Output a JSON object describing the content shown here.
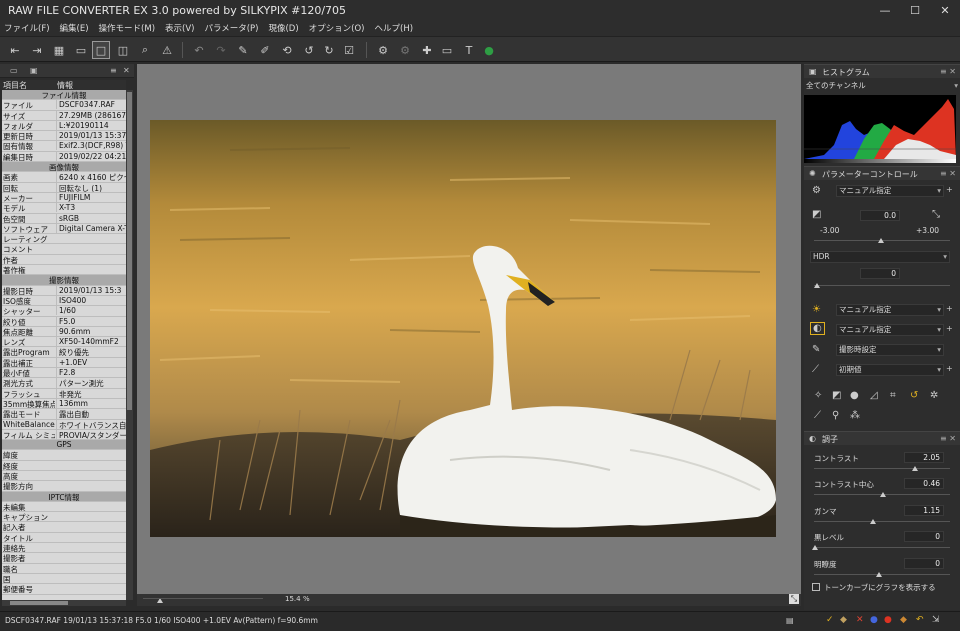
{
  "window": {
    "title": "RAW FILE CONVERTER EX 3.0 powered by SILKYPIX   #120/705"
  },
  "menu": [
    "ファイル(F)",
    "編集(E)",
    "操作モード(M)",
    "表示(V)",
    "パラメータ(P)",
    "現像(D)",
    "オプション(O)",
    "ヘルプ(H)"
  ],
  "left_panel": {
    "header": {
      "col1": "項目名",
      "col2": "情報"
    },
    "rows": [
      {
        "type": "section",
        "label": "ファイル情報"
      },
      {
        "k": "ファイル",
        "v": "DSCF0347.RAF"
      },
      {
        "k": "サイズ",
        "v": "27.29MB (2861678"
      },
      {
        "k": "フォルダ",
        "v": "L:¥20190114"
      },
      {
        "k": "更新日時",
        "v": "2019/01/13 15:37:1"
      },
      {
        "k": "固有情報",
        "v": "Exif2.3(DCF,R98) Y"
      },
      {
        "k": "編集日時",
        "v": "2019/02/22 04:21:"
      },
      {
        "type": "section",
        "label": "画像情報"
      },
      {
        "k": "画素",
        "v": "6240 x 4160 ピクセル"
      },
      {
        "k": "回転",
        "v": "回転なし (1)"
      },
      {
        "k": "メーカー",
        "v": "FUJIFILM"
      },
      {
        "k": "モデル",
        "v": "X-T3"
      },
      {
        "k": "色空間",
        "v": "sRGB"
      },
      {
        "k": "ソフトウェア",
        "v": "Digital Camera X-T"
      },
      {
        "k": "レーティング",
        "v": ""
      },
      {
        "k": "コメント",
        "v": ""
      },
      {
        "k": "作者",
        "v": ""
      },
      {
        "k": "著作権",
        "v": ""
      },
      {
        "type": "section",
        "label": "撮影情報"
      },
      {
        "k": "撮影日時",
        "v": "2019/01/13 15:3"
      },
      {
        "k": "ISO感度",
        "v": "ISO400"
      },
      {
        "k": "シャッター",
        "v": "1/60"
      },
      {
        "k": "絞り値",
        "v": "F5.0"
      },
      {
        "k": "焦点距離",
        "v": "90.6mm"
      },
      {
        "k": "レンズ",
        "v": "XF50-140mmF2"
      },
      {
        "k": "露出Program",
        "v": "絞り優先"
      },
      {
        "k": "露出補正",
        "v": "+1.0EV"
      },
      {
        "k": "最小F値",
        "v": "F2.8"
      },
      {
        "k": "測光方式",
        "v": "パターン測光"
      },
      {
        "k": "フラッシュ",
        "v": "非発光"
      },
      {
        "k": "35mm換算焦点",
        "v": "136mm"
      },
      {
        "k": "露出モード",
        "v": "露出自動"
      },
      {
        "k": "WhiteBalance",
        "v": "ホワイトバランス自動"
      },
      {
        "k": "フィルム シミュレー",
        "v": "PROVIA/スタンダード"
      },
      {
        "type": "section",
        "label": "GPS"
      },
      {
        "k": "緯度",
        "v": ""
      },
      {
        "k": "経度",
        "v": ""
      },
      {
        "k": "高度",
        "v": ""
      },
      {
        "k": "撮影方向",
        "v": ""
      },
      {
        "type": "section",
        "label": "IPTC情報"
      },
      {
        "k": "未編集",
        "v": ""
      },
      {
        "k": "キャプション",
        "v": ""
      },
      {
        "k": "記入者",
        "v": ""
      },
      {
        "k": "タイトル",
        "v": ""
      },
      {
        "k": "連絡先",
        "v": ""
      },
      {
        "k": "撮影者",
        "v": ""
      },
      {
        "k": "職名",
        "v": ""
      },
      {
        "k": "国",
        "v": ""
      },
      {
        "k": "郵便番号",
        "v": ""
      }
    ]
  },
  "center": {
    "zoom": "15.4",
    "zoom_unit": "%"
  },
  "status": {
    "text": "DSCF0347.RAF 19/01/13 15:37:18 F5.0 1/60 ISO400 +1.0EV Av(Pattern) f=90.6mm"
  },
  "right_panel": {
    "histogram": {
      "title": "ヒストグラム",
      "channel": "全てのチャンネル"
    },
    "params": {
      "title": "パラメーターコントロール",
      "preset": "マニュアル指定",
      "exposure_value": "0.0",
      "exposure_min": "-3.00",
      "exposure_max": "+3.00",
      "hdr_label": "HDR",
      "hdr_value": "0",
      "wb": "マニュアル指定",
      "tone_preset": "マニュアル指定",
      "film": "撮影時設定",
      "sharp": "初期値"
    },
    "tone": {
      "title": "調子",
      "contrast_label": "コントラスト",
      "contrast": "2.05",
      "center_label": "コントラスト中心",
      "center": "0.46",
      "gamma_label": "ガンマ",
      "gamma": "1.15",
      "black_label": "黒レベル",
      "black": "0",
      "clarity_label": "明瞭度",
      "clarity": "0",
      "curve_label": "トーンカーブにグラフを表示する"
    }
  },
  "colors": {
    "accent": "#2e9e44",
    "panel": "#2d2d2d",
    "canvas": "#7a7a7a"
  }
}
